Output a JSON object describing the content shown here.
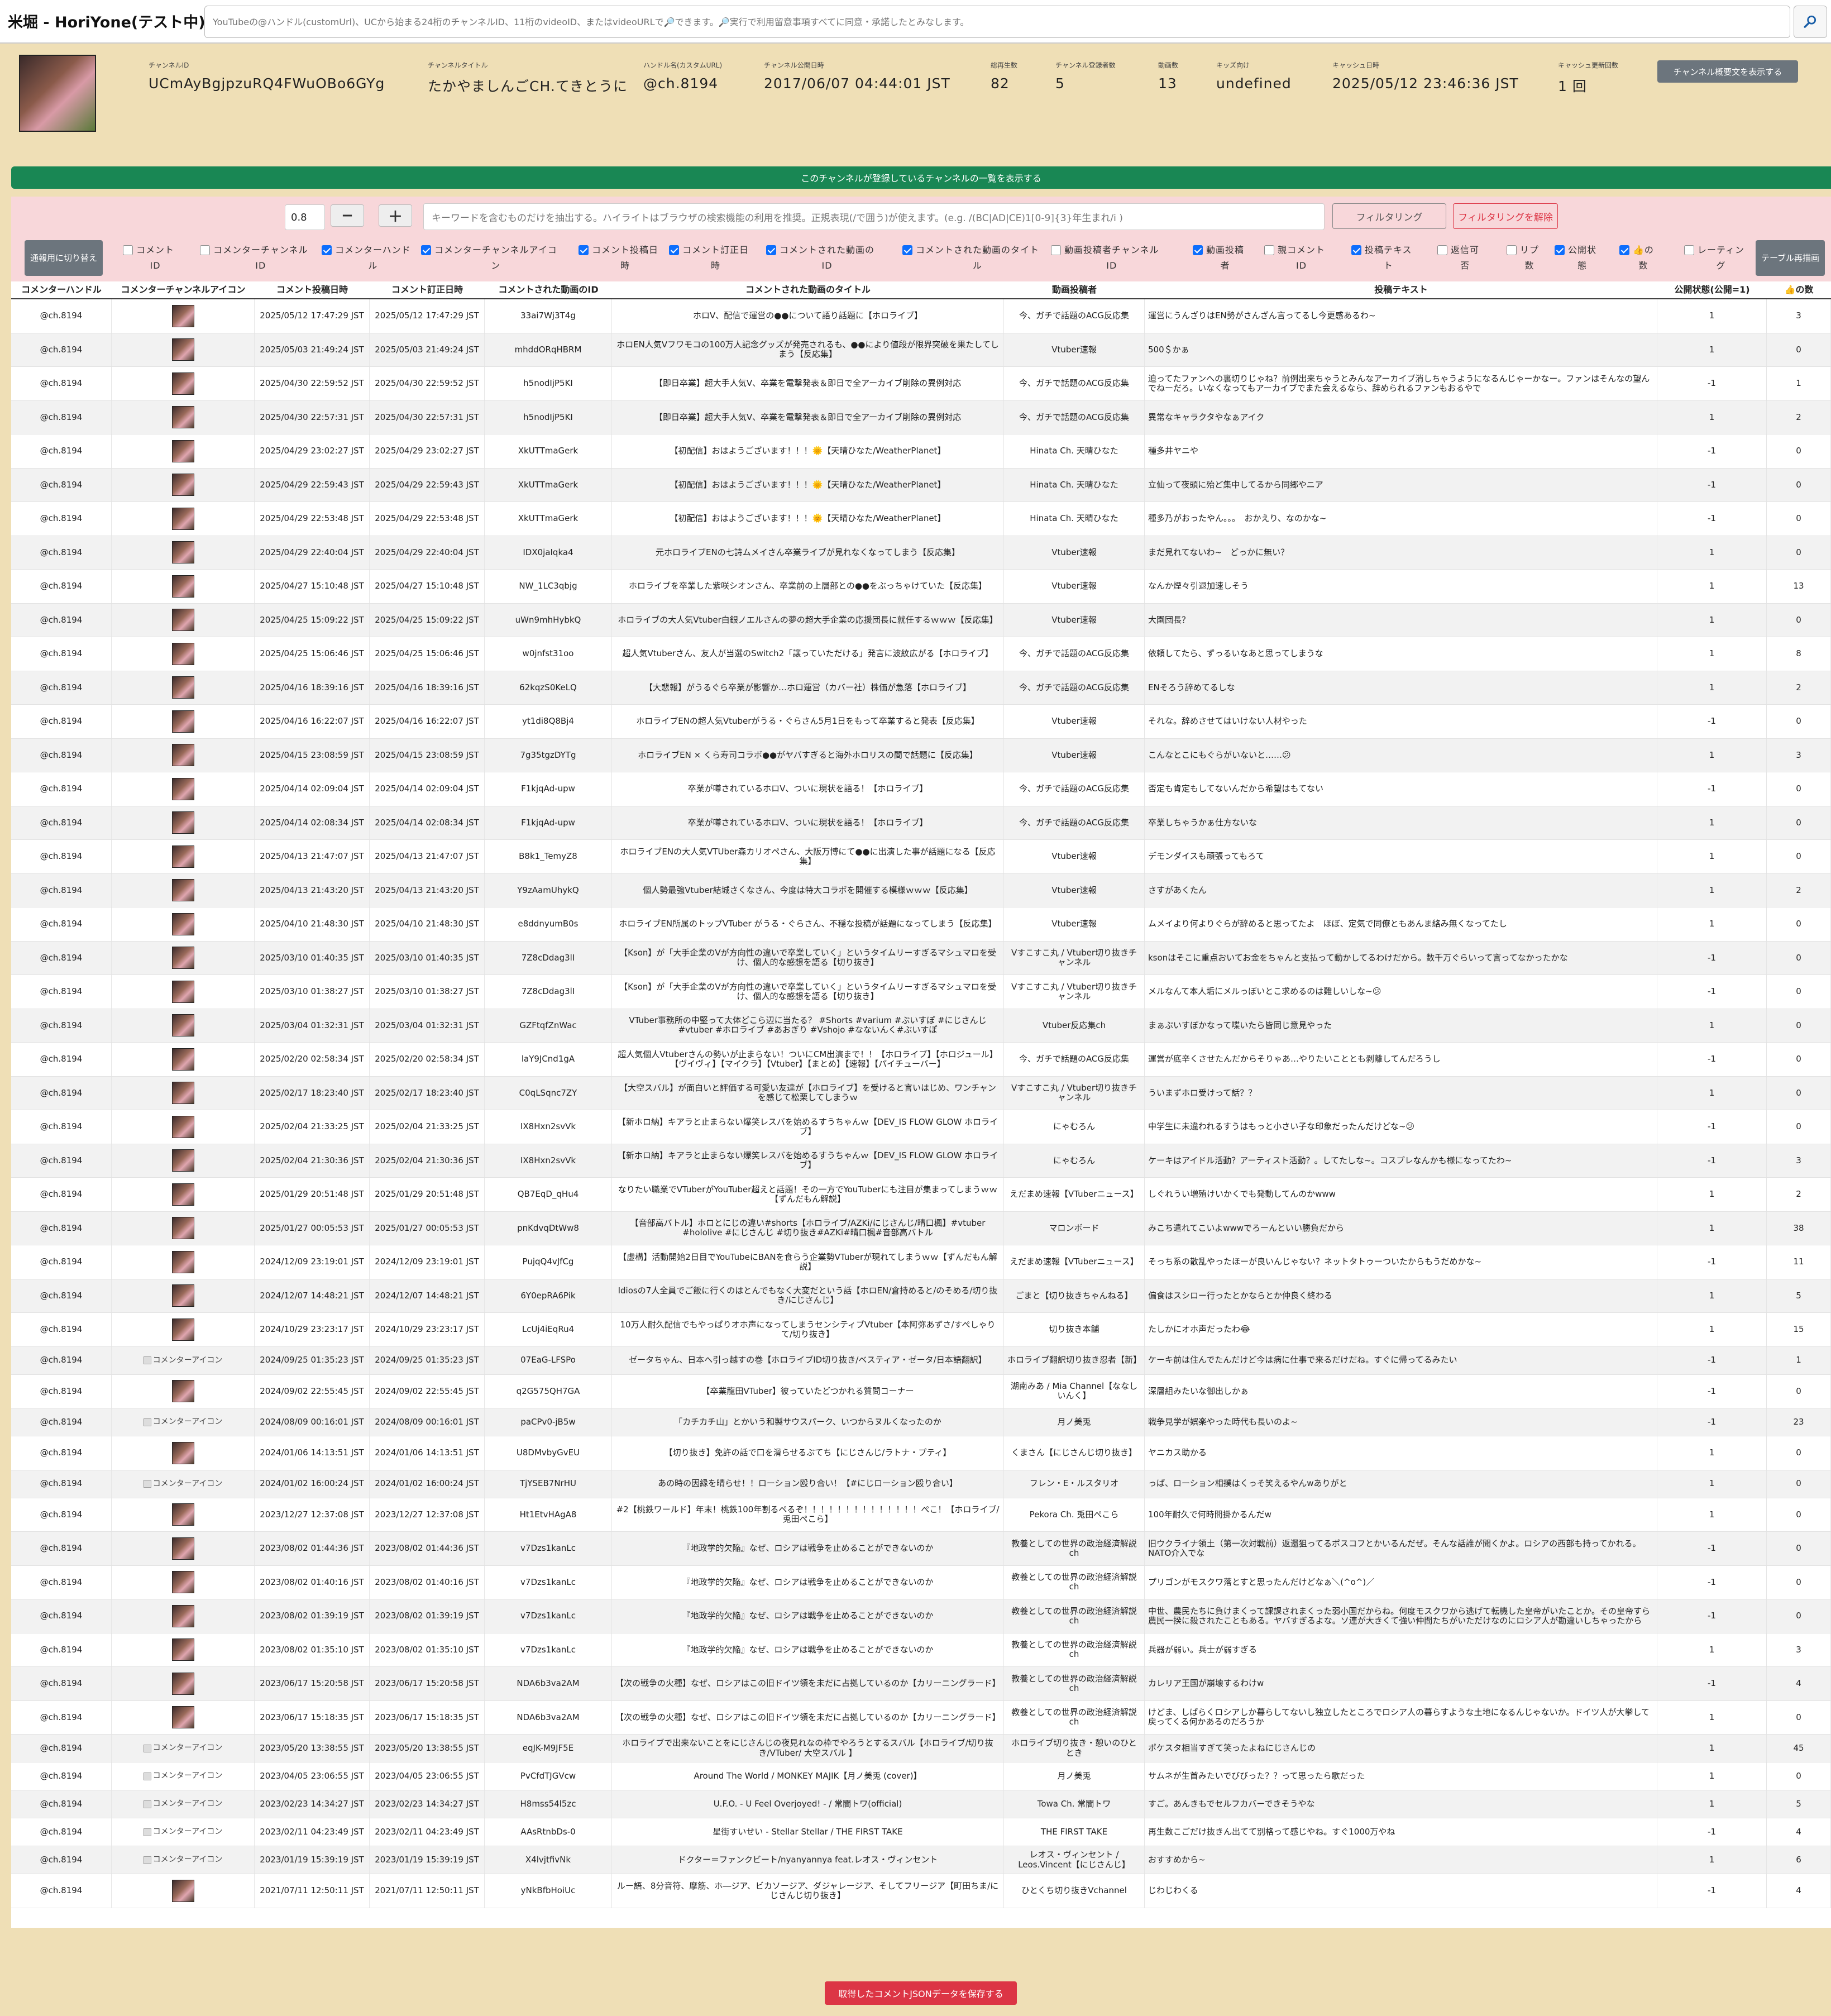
{
  "app": {
    "title": "米堀 - HoriYone(テスト中)"
  },
  "search": {
    "placeholder": "YouTubeの@ハンドル(customUrl)、UCから始まる24桁のチャンネルID、11桁のvideoID、またはvideoURLで🔎できます。🔎実行で利用留意事項すべてに同意・承諾したとみなします。"
  },
  "channel": {
    "items": [
      {
        "label": "チャンネルID",
        "value": "UCmAyBgjpzuRQ4FWuOBo6GYg"
      },
      {
        "label": "チャンネルタイトル",
        "value": "たかやましんごCH.てきとうに"
      },
      {
        "label": "ハンドル名(カスタムURL)",
        "value": "@ch.8194"
      },
      {
        "label": "チャンネル公開日時",
        "value": "2017/06/07 04:44:01 JST"
      },
      {
        "label": "総再生数",
        "value": "82"
      },
      {
        "label": "チャンネル登録者数",
        "value": "5"
      },
      {
        "label": "動画数",
        "value": "13"
      },
      {
        "label": "キッズ向け",
        "value": "undefined"
      },
      {
        "label": "キャッシュ日時",
        "value": "2025/05/12 23:46:36 JST"
      },
      {
        "label": "キャッシュ更新回数",
        "value": "1 回"
      }
    ],
    "summary_button": "チャンネル概要文を表示する"
  },
  "subscriptions_button": "このチャンネルが登録しているチャンネルの一覧を表示する",
  "filter": {
    "ratio": "0.8",
    "minus": "−",
    "plus": "＋",
    "keyword_placeholder": "キーワードを含むものだけを抽出する。ハイライトはブラウザの検索機能の利用を推奨。正規表現(/で囲う)が使えます。(e.g. /(BC|AD|CE)1[0-9]{3}年生まれ/i )",
    "filter_button": "フィルタリング",
    "clear_button": "フィルタリングを解除",
    "toggle_button": "通報用に切り替え",
    "redraw_button": "テーブル再描画",
    "checkboxes": [
      {
        "label": "コメント\nID",
        "checked": false
      },
      {
        "label": "コメンターチャンネル\nID",
        "checked": false
      },
      {
        "label": "コメンターハンド\nル",
        "checked": true
      },
      {
        "label": "コメンターチャンネルアイコ\nン",
        "checked": true
      },
      {
        "label": "コメント投稿日\n時",
        "checked": true
      },
      {
        "label": "コメント訂正日\n時",
        "checked": true
      },
      {
        "label": "コメントされた動画の\nID",
        "checked": true
      },
      {
        "label": "コメントされた動画のタイト\nル",
        "checked": true
      },
      {
        "label": "動画投稿者チャンネル\nID",
        "checked": false
      },
      {
        "label": "動画投稿\n者",
        "checked": true
      },
      {
        "label": "親コメント\nID",
        "checked": false
      },
      {
        "label": "投稿テキス\nト",
        "checked": true
      },
      {
        "label": "返信可\n否",
        "checked": false
      },
      {
        "label": "リプ\n数",
        "checked": false
      },
      {
        "label": "公開状\n態",
        "checked": true
      },
      {
        "label": "👍の\n数",
        "checked": true
      },
      {
        "label": "レーティン\nグ",
        "checked": false
      }
    ]
  },
  "table": {
    "headers": [
      "コメンターハンドル",
      "コメンターチャンネルアイコン",
      "コメント投稿日時",
      "コメント訂正日時",
      "コメントされた動画のID",
      "コメントされた動画のタイトル",
      "動画投稿者",
      "投稿テキスト",
      "公開状態(公開=1)",
      "👍の数"
    ],
    "rows": [
      [
        "@ch.8194",
        "img",
        "2025/05/12 17:47:29 JST",
        "2025/05/12 17:47:29 JST",
        "33ai7Wj3T4g",
        "ホロV、配信で運営の●●について語り話題に【ホロライブ】",
        "今、ガチで話題のACG反応集",
        "運営にうんざりはEN勢がさんざん言ってるし今更感あるわ~",
        "1",
        "3"
      ],
      [
        "@ch.8194",
        "img",
        "2025/05/03 21:49:24 JST",
        "2025/05/03 21:49:24 JST",
        "mhddORqHBRM",
        "ホロEN人気Vフワモコの100万人記念グッズが発売されるも、●●により値段が限界突破を果たしてしまう【反応集】",
        "Vtuber速報",
        "500＄かぁ",
        "1",
        "0"
      ],
      [
        "@ch.8194",
        "img",
        "2025/04/30 22:59:52 JST",
        "2025/04/30 22:59:52 JST",
        "h5nodIjP5KI",
        "【即日卒業】超大手人気V、卒業を電撃発表＆即日で全アーカイブ削除の異例対応",
        "今、ガチで話題のACG反応集",
        "迫ってたファンへの裏切りじゃね？前例出来ちゃうとみんなアーカイブ消しちゃうようになるんじゃーかなー。ファンはそんなの望んでねーだろ。いなくなってもアーカイブでまた会えるなら、辞められるファンもおるやで",
        "-1",
        "1"
      ],
      [
        "@ch.8194",
        "img",
        "2025/04/30 22:57:31 JST",
        "2025/04/30 22:57:31 JST",
        "h5nodIjP5KI",
        "【即日卒業】超大手人気V、卒業を電撃発表＆即日で全アーカイブ削除の異例対応",
        "今、ガチで話題のACG反応集",
        "異常なキャラクタやなぁアイク",
        "1",
        "2"
      ],
      [
        "@ch.8194",
        "img",
        "2025/04/29 23:02:27 JST",
        "2025/04/29 23:02:27 JST",
        "XkUTTmaGerk",
        "【初配信】おはようございます！！！🌞【天晴ひなた/WeatherPlanet】",
        "Hinata Ch. 天晴ひなた",
        "種多井ヤニや",
        "-1",
        "0"
      ],
      [
        "@ch.8194",
        "img",
        "2025/04/29 22:59:43 JST",
        "2025/04/29 22:59:43 JST",
        "XkUTTmaGerk",
        "【初配信】おはようございます！！！🌞【天晴ひなた/WeatherPlanet】",
        "Hinata Ch. 天晴ひなた",
        "立仙って夜頭に殆ど集中してるから同郷やニア",
        "-1",
        "0"
      ],
      [
        "@ch.8194",
        "img",
        "2025/04/29 22:53:48 JST",
        "2025/04/29 22:53:48 JST",
        "XkUTTmaGerk",
        "【初配信】おはようございます！！！🌞【天晴ひなた/WeatherPlanet】",
        "Hinata Ch. 天晴ひなた",
        "種多乃がおったやん。。。　おかえり、なのかな~",
        "-1",
        "0"
      ],
      [
        "@ch.8194",
        "img",
        "2025/04/29 22:40:04 JST",
        "2025/04/29 22:40:04 JST",
        "IDX0jaIqka4",
        "元ホロライブENの七詩ムメイさん卒業ライブが見れなくなってしまう【反応集】",
        "Vtuber速報",
        "まだ見れてないわ~　どっかに無い？",
        "1",
        "0"
      ],
      [
        "@ch.8194",
        "img",
        "2025/04/27 15:10:48 JST",
        "2025/04/27 15:10:48 JST",
        "NW_1LC3qbjg",
        "ホロライブを卒業した紫咲シオンさん、卒業前の上層部との●●をぶっちゃけていた【反応集】",
        "Vtuber速報",
        "なんか煙々引退加速しそう",
        "1",
        "13"
      ],
      [
        "@ch.8194",
        "img",
        "2025/04/25 15:09:22 JST",
        "2025/04/25 15:09:22 JST",
        "uWn9mhHybkQ",
        "ホロライブの大人気Vtuber白銀ノエルさんの夢の超大手企業の応援団長に就任するｗｗｗ【反応集】",
        "Vtuber速報",
        "大園団長？",
        "1",
        "0"
      ],
      [
        "@ch.8194",
        "img",
        "2025/04/25 15:06:46 JST",
        "2025/04/25 15:06:46 JST",
        "w0jnfst31oo",
        "超人気Vtuberさん、友人が当選のSwitch2「譲っていただける」発言に波紋広がる【ホロライブ】",
        "今、ガチで話題のACG反応集",
        "依頼してたら、ずっるいなあと思ってしまうな",
        "1",
        "8"
      ],
      [
        "@ch.8194",
        "img",
        "2025/04/16 18:39:16 JST",
        "2025/04/16 18:39:16 JST",
        "62kqzS0KeLQ",
        "【大悲報】がうるぐら卒業が影響か…ホロ運営（カバー社）株価が急落【ホロライブ】",
        "今、ガチで話題のACG反応集",
        "ENそろう辞めてるしな",
        "1",
        "2"
      ],
      [
        "@ch.8194",
        "img",
        "2025/04/16 16:22:07 JST",
        "2025/04/16 16:22:07 JST",
        "yt1di8Q8Bj4",
        "ホロライブENの超人気Vtuberがうる・ぐらさん5月1日をもって卒業すると発表【反応集】",
        "Vtuber速報",
        "それな。辞めさせてはいけない人材やった",
        "-1",
        "0"
      ],
      [
        "@ch.8194",
        "img",
        "2025/04/15 23:08:59 JST",
        "2025/04/15 23:08:59 JST",
        "7g35tgzDYTg",
        "ホロライブEN × くら寿司コラボ●●がヤバすぎると海外ホロリスの間で話題に【反応集】",
        "Vtuber速報",
        "こんなとこにもぐらがいないと……😕",
        "1",
        "3"
      ],
      [
        "@ch.8194",
        "img",
        "2025/04/14 02:09:04 JST",
        "2025/04/14 02:09:04 JST",
        "F1kjqAd-upw",
        "卒業が噂されているホロV、ついに現状を語る！【ホロライブ】",
        "今、ガチで話題のACG反応集",
        "否定も肯定もしてないんだから希望はもてない",
        "-1",
        "0"
      ],
      [
        "@ch.8194",
        "img",
        "2025/04/14 02:08:34 JST",
        "2025/04/14 02:08:34 JST",
        "F1kjqAd-upw",
        "卒業が噂されているホロV、ついに現状を語る！【ホロライブ】",
        "今、ガチで話題のACG反応集",
        "卒業しちゃうかぁ仕方ないな",
        "1",
        "0"
      ],
      [
        "@ch.8194",
        "img",
        "2025/04/13 21:47:07 JST",
        "2025/04/13 21:47:07 JST",
        "B8k1_TemyZ8",
        "ホロライブENの大人気VTUber森カリオペさん、大阪万博にて●●に出演した事が話題になる【反応集】",
        "Vtuber速報",
        "デモンダイスも頑張ってもろて",
        "1",
        "0"
      ],
      [
        "@ch.8194",
        "img",
        "2025/04/13 21:43:20 JST",
        "2025/04/13 21:43:20 JST",
        "Y9zAamUhykQ",
        "個人勢最強Vtuber結城さくなさん、今度は特大コラボを開催する模様ｗｗｗ【反応集】",
        "Vtuber速報",
        "さすがあくたん",
        "1",
        "2"
      ],
      [
        "@ch.8194",
        "img",
        "2025/04/10 21:48:30 JST",
        "2025/04/10 21:48:30 JST",
        "e8ddnyumB0s",
        "ホロライブEN所属のトップVTuber がうる・ぐらさん、不穏な投稿が話題になってしまう【反応集】",
        "Vtuber速報",
        "ムメイより何よりぐらが辞めると思ってたよ　ほぼ、定気で同僚ともあんま絡み無くなってたし",
        "1",
        "0"
      ],
      [
        "@ch.8194",
        "img",
        "2025/03/10 01:40:35 JST",
        "2025/03/10 01:40:35 JST",
        "7Z8cDdag3lI",
        "【Kson】が「大手企業のVが方向性の違いで卒業していく」というタイムリーすぎるマシュマロを受け、個人的な感想を語る【切り抜き】",
        "Vすこすこ丸 / Vtuber切り抜きチャンネル",
        "ksonはそこに重点おいてお金をちゃんと支払って動かしてるわけだから。数千万ぐらいって言ってなかったかな",
        "-1",
        "0"
      ],
      [
        "@ch.8194",
        "img",
        "2025/03/10 01:38:27 JST",
        "2025/03/10 01:38:27 JST",
        "7Z8cDdag3lI",
        "【Kson】が「大手企業のVが方向性の違いで卒業していく」というタイムリーすぎるマシュマロを受け、個人的な感想を語る【切り抜き】",
        "Vすこすこ丸 / Vtuber切り抜きチャンネル",
        "メルなんて本人垢にメルっぽいとこ求めるのは難しいしな~😕",
        "-1",
        "0"
      ],
      [
        "@ch.8194",
        "img",
        "2025/03/04 01:32:31 JST",
        "2025/03/04 01:32:31 JST",
        "GZFtqfZnWac",
        "VTuber事務所の中堅って大体どこら辺に当たる？ #Shorts #varium #ぶいすぽ #にじさんじ #vtuber #ホロライブ #あおぎり #Vshojo #なないんく#ぶいすぽ",
        "Vtuber反応集ch",
        "まぁぶいすぽかなって喋いたら皆同じ意見やった",
        "1",
        "0"
      ],
      [
        "@ch.8194",
        "img",
        "2025/02/20 02:58:34 JST",
        "2025/02/20 02:58:34 JST",
        "laY9JCnd1gA",
        "超人気個人Vtuberさんの勢いが止まらない！ついにCM出演まで！！【ホロライブ】【ホロジュール】【ヴイヴィ】【マイクラ】【Vtuber】【まとめ】【速報】【パイチューバー】",
        "今、ガチで話題のACG反応集",
        "運営が底辛くさせたんだからそりゃあ…やりたいこととも剥離してんだろうし",
        "-1",
        "0"
      ],
      [
        "@ch.8194",
        "img",
        "2025/02/17 18:23:40 JST",
        "2025/02/17 18:23:40 JST",
        "C0qLSqnc7ZY",
        "【大空スバル】が面白いと評価する可愛い友達が【ホロライブ】を受けると言いはじめ、ワンチャンを感じて松栗してしまうｗ",
        "Vすこすこ丸 / Vtuber切り抜きチャンネル",
        "ういまずホロ受けって話？？",
        "1",
        "0"
      ],
      [
        "@ch.8194",
        "img",
        "2025/02/04 21:33:25 JST",
        "2025/02/04 21:33:25 JST",
        "IX8Hxn2svVk",
        "【新ホロ納】キアラと止まらない爆笑レスバを始めるすうちゃんｗ【DEV_IS FLOW GLOW ホロライブ】",
        "にゃむろん",
        "中学生に未違われるすうはもっと小さい子な印象だったんだけどな~😕",
        "-1",
        "0"
      ],
      [
        "@ch.8194",
        "img",
        "2025/02/04 21:30:36 JST",
        "2025/02/04 21:30:36 JST",
        "IX8Hxn2svVk",
        "【新ホロ納】キアラと止まらない爆笑レスバを始めるすうちゃんｗ【DEV_IS FLOW GLOW ホロライブ】",
        "にゃむろん",
        "ケーキはアイドル活動？アーティスト活動？。してたしな~。コスプレなんかも様になってたわ~",
        "-1",
        "3"
      ],
      [
        "@ch.8194",
        "img",
        "2025/01/29 20:51:48 JST",
        "2025/01/29 20:51:48 JST",
        "QB7EqD_qHu4",
        "なりたい職業でVTuberがYouTuber超えと話題！その一方でYouTuberにも注目が集まってしまうｗｗ【ずんだもん解説】",
        "えだまめ速報【VTuberニュース】",
        "しぐれうい増殖けいかくでも発動してんのかwww",
        "1",
        "2"
      ],
      [
        "@ch.8194",
        "img",
        "2025/01/27 00:05:53 JST",
        "2025/01/27 00:05:53 JST",
        "pnKdvqDtWw8",
        "【音部高バトル】ホロとにじの違い#shorts【ホロライブ/AZKi/にじさんじ/晴口楓】#vtuber #hololive #にじさんじ #切り抜き#AZKi#晴口楓#音部高バトル",
        "マロンボード",
        "みこち遣れてこいよwwwでろーんといい勝負だから",
        "1",
        "38"
      ],
      [
        "@ch.8194",
        "img",
        "2024/12/09 23:19:01 JST",
        "2024/12/09 23:19:01 JST",
        "PujqQ4vJfCg",
        "【虚構】活動開始2日目でYouTubeにBANを食らう企業勢VTuberが現れてしまうｗｗ【ずんだもん解説】",
        "えだまめ速報【VTuberニュース】",
        "そっち系の散乱やったほーが良いんじゃない？ネットタトゥーついたからもうだめかな~",
        "-1",
        "11"
      ],
      [
        "@ch.8194",
        "img",
        "2024/12/07 14:48:21 JST",
        "2024/12/07 14:48:21 JST",
        "6Y0epRA6Pik",
        "Idiosの7人全員でご飯に行くのはとんでもなく大変だという話【ホロEN/倉持めると/のそめる/切り抜き/にじさんじ】",
        "ごまと【切り抜きちゃんねる】",
        "偏食はスシロー行ったとかならとか仲良く終わる",
        "1",
        "5"
      ],
      [
        "@ch.8194",
        "img",
        "2024/10/29 23:23:17 JST",
        "2024/10/29 23:23:17 JST",
        "LcUj4iEqRu4",
        "10万人耐久配信でもやっぱりオホ声になってしまうセンシティブVtuber【本阿弥あずさ/すぺしゃりて/切り抜き】",
        "切り抜き本舗",
        "たしかにオホ声だったわ😂",
        "1",
        "15"
      ],
      [
        "@ch.8194",
        "broken",
        "2024/09/25 01:35:23 JST",
        "2024/09/25 01:35:23 JST",
        "07EaG-LFSPo",
        "ゼータちゃん、日本へ引っ越すの巻【ホロライブID切り抜き/ベスティア・ゼータ/日本語翻訳】",
        "ホロライブ翻訳切り抜き忍者【新】",
        "ケーキ前は住んでたんだけど今は病に仕事で来るだけだね。すぐに帰ってるみたい",
        "-1",
        "1"
      ],
      [
        "@ch.8194",
        "img",
        "2024/09/02 22:55:45 JST",
        "2024/09/02 22:55:45 JST",
        "q2G575QH7GA",
        "【卒業龍田VTuber】彼っていたどつかれる質問コーナー",
        "湖南みあ / Mia Channel【ななしいんく】",
        "深層組みたいな御出しかぁ",
        "-1",
        "0"
      ],
      [
        "@ch.8194",
        "broken",
        "2024/08/09 00:16:01 JST",
        "2024/08/09 00:16:01 JST",
        "paCPv0-jB5w",
        "「カチカチ山」とかいう和製サウスパーク、いつからヌルくなったのか",
        "月ノ美兎",
        "戦争見学が娯楽やった時代も長いのよ~",
        "-1",
        "23"
      ],
      [
        "@ch.8194",
        "img",
        "2024/01/06 14:13:51 JST",
        "2024/01/06 14:13:51 JST",
        "U8DMvbyGvEU",
        "【切り抜き】免許の話で口を滑らせるぶてち【にじさんじ/ラトナ・プティ】",
        "くまさん【にじさんじ切り抜き】",
        "ヤニカス助かる",
        "1",
        "0"
      ],
      [
        "@ch.8194",
        "broken",
        "2024/01/02 16:00:24 JST",
        "2024/01/02 16:00:24 JST",
        "TjYSEB7NrHU",
        "あの時の因縁を晴らせ！！ローション殴り合い！【#にじローション殴り合い】",
        "フレン・E・ルスタリオ",
        "っぱ、ローション相撲はくっそ笑えるやんwありがと",
        "1",
        "0"
      ],
      [
        "@ch.8194",
        "img",
        "2023/12/27 12:37:08 JST",
        "2023/12/27 12:37:08 JST",
        "Ht1EtvHAgA8",
        "#2【桃鉄ワールド】年末！桃鉄100年割るペるぞ！！！！！！！！！！！！！！ぺこ！【ホロライブ/兎田ぺこら】",
        "Pekora Ch. 兎田ぺこら",
        "100年耐久で何時間掛かるんだw",
        "1",
        "0"
      ],
      [
        "@ch.8194",
        "img",
        "2023/08/02 01:44:36 JST",
        "2023/08/02 01:44:36 JST",
        "v7Dzs1kanLc",
        "『地政学的欠陥』なぜ、ロシアは戦争を止めることができないのか",
        "教養としての世界の政治経済解説ch",
        "旧ウクライナ領土（第一次対戦前）返還狙ってるポスコフとかいるんだぜ。そんな話誰が聞くかよ。ロシアの西部も持ってかれる。NATO介入でな",
        "-1",
        "0"
      ],
      [
        "@ch.8194",
        "img",
        "2023/08/02 01:40:16 JST",
        "2023/08/02 01:40:16 JST",
        "v7Dzs1kanLc",
        "『地政学的欠陥』なぜ、ロシアは戦争を止めることができないのか",
        "教養としての世界の政治経済解説ch",
        "プリゴンがモスクワ落とすと思ったんだけどなぁ＼(^o^)／",
        "-1",
        "0"
      ],
      [
        "@ch.8194",
        "img",
        "2023/08/02 01:39:19 JST",
        "2023/08/02 01:39:19 JST",
        "v7Dzs1kanLc",
        "『地政学的欠陥』なぜ、ロシアは戦争を止めることができないのか",
        "教養としての世界の政治経済解説ch",
        "中世、農民たちに負けまくって課課されまくった弱小国だからね。何度モスクワから逃げて転機した皇帝がいたことか。その皇帝すら農民一揆に殺されたこともある。ヤバすぎるよな。ソ連が大きくて強い仲間たちがいただけなのにロシア人が勘違いしちゃったから",
        "-1",
        "0"
      ],
      [
        "@ch.8194",
        "img",
        "2023/08/02 01:35:10 JST",
        "2023/08/02 01:35:10 JST",
        "v7Dzs1kanLc",
        "『地政学的欠陥』なぜ、ロシアは戦争を止めることができないのか",
        "教養としての世界の政治経済解説ch",
        "兵器が弱い。兵士が弱すぎる",
        "1",
        "3"
      ],
      [
        "@ch.8194",
        "img",
        "2023/06/17 15:20:58 JST",
        "2023/06/17 15:20:58 JST",
        "NDA6b3va2AM",
        "【次の戦争の火種】なぜ、ロシアはこの旧ドイツ領を未だに占拠しているのか【カリーニングラード】",
        "教養としての世界の政治経済解説ch",
        "カレリア王国が崩壊するわけw",
        "-1",
        "4"
      ],
      [
        "@ch.8194",
        "img",
        "2023/06/17 15:18:35 JST",
        "2023/06/17 15:18:35 JST",
        "NDA6b3va2AM",
        "【次の戦争の火種】なぜ、ロシアはこの旧ドイツ領を未だに占拠しているのか【カリーニングラード】",
        "教養としての世界の政治経済解説ch",
        "けどま、しばらくロシアしか暮らしてないし独立したところでロシア人の暮らすような土地になるんじゃないか。ドイツ人が大挙して戻ってくる何かあるのだろうか",
        "1",
        "0"
      ],
      [
        "@ch.8194",
        "broken",
        "2023/05/20 13:38:55 JST",
        "2023/05/20 13:38:55 JST",
        "eqJK-M9JF5E",
        "ホロライブで出来ないことをにじさんじの夜見れなの枠でやろうとするスバル【ホロライブ/切り抜き/VTuber/ 大空スバル 】",
        "ホロライブ切り抜き・憩いのひととき",
        "ポケスタ相当すぎて笑ったよねにじさんじの",
        "1",
        "45"
      ],
      [
        "@ch.8194",
        "broken",
        "2023/04/05 23:06:55 JST",
        "2023/04/05 23:06:55 JST",
        "PvCfdTJGVcw",
        "Around The World / MONKEY MAJIK【月ノ美兎 (cover)】",
        "月ノ美兎",
        "サムネが生首みたいでびびった？？って思ったら歌だった",
        "1",
        "0"
      ],
      [
        "@ch.8194",
        "broken",
        "2023/02/23 14:34:27 JST",
        "2023/02/23 14:34:27 JST",
        "H8mss54l5zc",
        "U.F.O. - U Feel Overjoyed! - / 常闇トワ(official)",
        "Towa Ch. 常闇トワ",
        "すご。あんきもでセルフカバーできそうやな",
        "1",
        "5"
      ],
      [
        "@ch.8194",
        "broken",
        "2023/02/11 04:23:49 JST",
        "2023/02/11 04:23:49 JST",
        "AAsRtnbDs-0",
        "星街すいせい - Stellar Stellar / THE FIRST TAKE",
        "THE FIRST TAKE",
        "再生数こごだけ抜きん出てて別格って感じやね。すぐ1000万やね",
        "-1",
        "4"
      ],
      [
        "@ch.8194",
        "broken",
        "2023/01/19 15:39:19 JST",
        "2023/01/19 15:39:19 JST",
        "X4lvjtfivNk",
        "ドクター＝ファンクビート/nyanyannya feat.レオス・ヴィンセント",
        "レオス・ヴィンセント / Leos.Vincent【にじさんじ】",
        "おすすめから~",
        "1",
        "6"
      ],
      [
        "@ch.8194",
        "img",
        "2021/07/11 12:50:11 JST",
        "2021/07/11 12:50:11 JST",
        "yNkBfbHoiUc",
        "ルー語、8分音符、摩筋、ホ―ジア、ビカソージア、ダジャレージア、そしてフリージア【町田ちま/にじさんじ切り抜き】",
        "ひとくち切り抜きVchannel",
        "じわじわくる",
        "-1",
        "4"
      ]
    ],
    "broken_icon_alt": "コメンターアイコン"
  },
  "save_button": "取得したコメントJSONデータを保存する"
}
